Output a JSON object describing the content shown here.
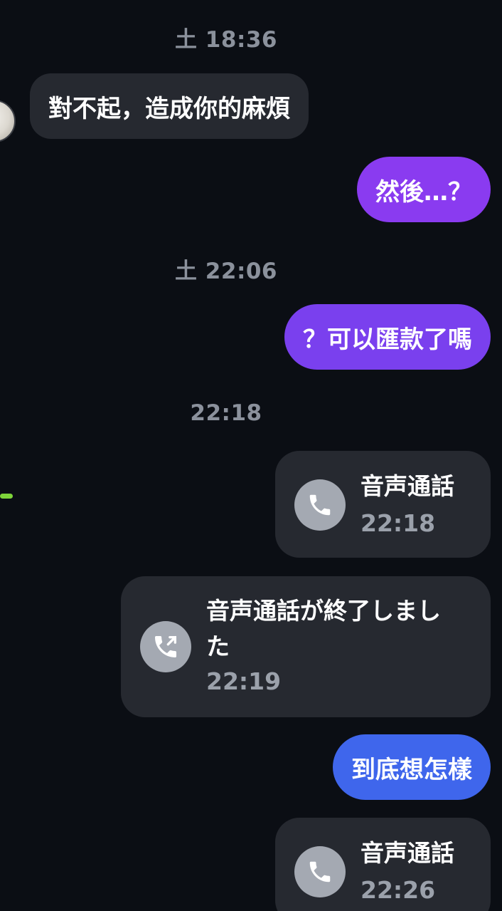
{
  "chat": {
    "timestamps": [
      "土 18:36",
      "土 22:06",
      "22:18"
    ],
    "messages": {
      "incoming_1": "對不起，造成你的麻煩",
      "outgoing_1": "然後…？",
      "outgoing_2": "？可以匯款了嗎",
      "outgoing_3": "到底想怎樣"
    },
    "calls": [
      {
        "title": "音声通話",
        "time": "22:18",
        "icon": "phone-icon"
      },
      {
        "title": "音声通話が終了しました",
        "time": "22:19",
        "icon": "phone-outgoing-icon"
      },
      {
        "title": "音声通話",
        "time": "22:26",
        "icon": "phone-icon"
      }
    ]
  },
  "colors": {
    "background": "#0b0e14",
    "incoming_bubble": "#262930",
    "outgoing_purple": "#8a3bf0",
    "outgoing_violet": "#7a40ee",
    "outgoing_blue": "#3f66ec"
  }
}
